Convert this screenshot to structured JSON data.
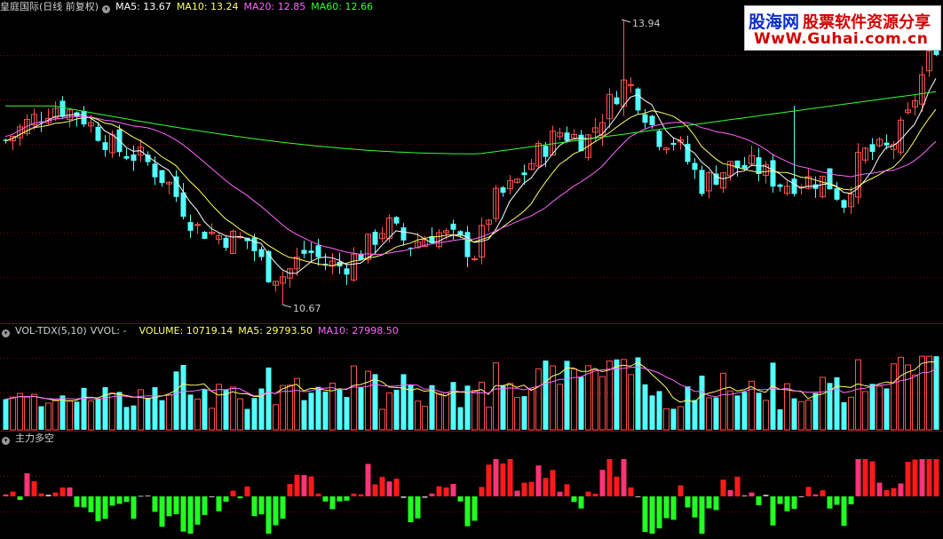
{
  "price_panel": {
    "title": "皇庭国际(日线 前复权)",
    "ma5": "MA5: 13.67",
    "ma10": "MA10: 13.24",
    "ma20": "MA20: 12.85",
    "ma60": "MA60: 12.66",
    "high_label": "13.94",
    "low_label": "10.67"
  },
  "volume_panel": {
    "title": "VOL-TDX(5,10)",
    "vvol": "VVOL: -",
    "volume": "VOLUME: 10719.14",
    "ma5": "MA5: 29793.50",
    "ma10": "MA10: 27998.50"
  },
  "power_panel": {
    "title": "主力多空"
  },
  "watermark": {
    "site_name": "股海网",
    "tagline": "股票软件资源分享",
    "url": "WwW.Guhai.com.cn"
  },
  "colors": {
    "up": "#ff5050",
    "down": "#54ffff",
    "ma5": "#ffffff",
    "ma10": "#ffff66",
    "ma20": "#ff66ff",
    "ma60": "#33ff33",
    "bull_red": "#ff1a1a",
    "bull_pink": "#ff3377",
    "bear_green": "#22ff22",
    "neutral_gray": "#bdbdbd",
    "grid": "#7a0000"
  }
}
